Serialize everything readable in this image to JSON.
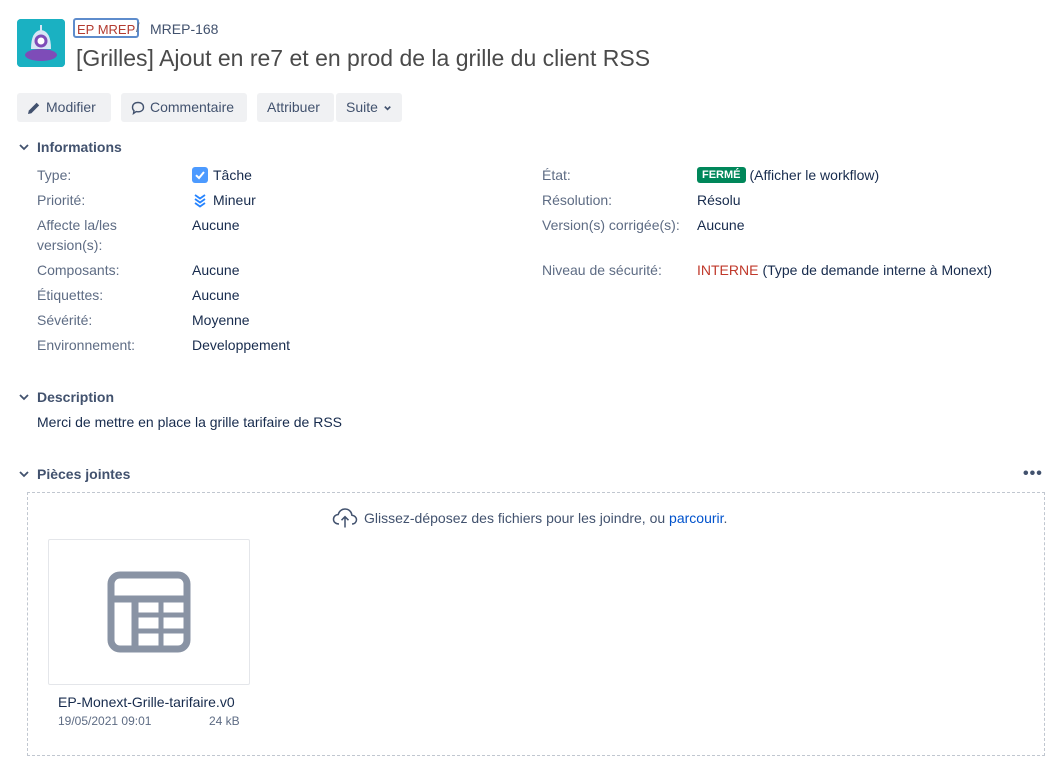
{
  "breadcrumb": {
    "project": "EP MREP",
    "separator": "/",
    "issue_key": "MREP-168"
  },
  "issue": {
    "title": "[Grilles] Ajout en re7 et en prod de la grille du client RSS"
  },
  "toolbar": {
    "edit": "Modifier",
    "comment": "Commentaire",
    "assign": "Attribuer",
    "more": "Suite"
  },
  "sections": {
    "details": "Informations",
    "description": "Description",
    "attachments": "Pièces jointes"
  },
  "fields_left": {
    "type": {
      "label": "Type:",
      "value": "Tâche",
      "icon": "task-checkbox-icon"
    },
    "priority": {
      "label": "Priorité:",
      "value": "Mineur",
      "icon": "priority-minor-icon"
    },
    "affects": {
      "label_line1": "Affecte la/les",
      "label_line2": "version(s):",
      "value": "Aucune"
    },
    "components": {
      "label": "Composants:",
      "value": "Aucune"
    },
    "labels": {
      "label": "Étiquettes:",
      "value": "Aucune"
    },
    "severity": {
      "label": "Sévérité:",
      "value": "Moyenne"
    },
    "environment": {
      "label": "Environnement:",
      "value": "Developpement"
    }
  },
  "fields_right": {
    "status": {
      "label": "État:",
      "lozenge": "FERMÉ",
      "link": "(Afficher le workflow)"
    },
    "resolution": {
      "label": "Résolution:",
      "value": "Résolu"
    },
    "fix_versions": {
      "label": "Version(s) corrigée(s):",
      "value": "Aucune"
    },
    "security": {
      "label": "Niveau de sécurité:",
      "level": "INTERNE",
      "detail": "(Type de demande interne à Monext)"
    }
  },
  "description": {
    "text": "Merci de mettre en place la grille tarifaire de RSS"
  },
  "attachments": {
    "more_label": "•••",
    "drop_text": "Glissez-déposez des fichiers pour les joindre, ou",
    "browse_link": "parcourir",
    "period": ".",
    "files": [
      {
        "name": "EP-Monext-Grille-tarifaire.v0",
        "date": "19/05/2021 09:01",
        "size": "24 kB",
        "icon": "spreadsheet-icon"
      }
    ]
  },
  "colors": {
    "status_closed": "#00875a",
    "security_level": "#c0392b",
    "link": "#0052cc",
    "avatar_bg": "#1ab1c2"
  }
}
